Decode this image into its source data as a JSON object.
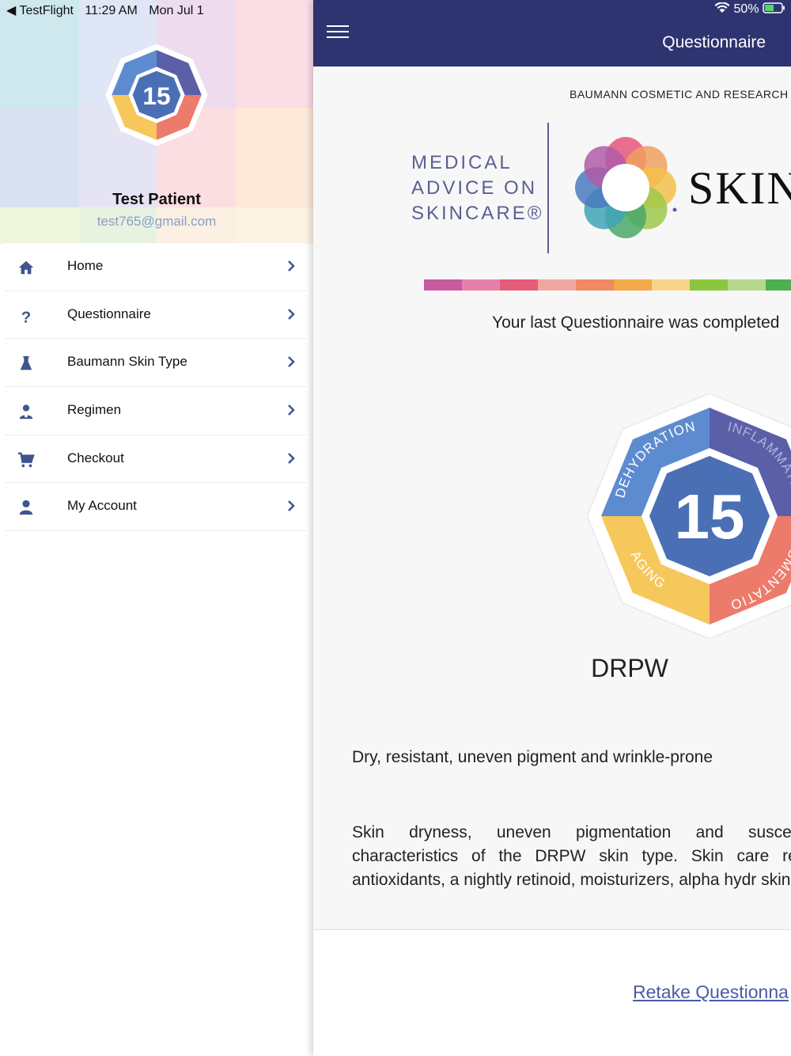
{
  "status_bar": {
    "back_app": "◀ TestFlight",
    "time": "11:29 AM",
    "date": "Mon Jul 1",
    "battery": "50%"
  },
  "drawer": {
    "badge_number": "15",
    "patient_name": "Test Patient",
    "patient_email": "test765@gmail.com",
    "menu": [
      {
        "label": "Home",
        "icon": "home-icon"
      },
      {
        "label": "Questionnaire",
        "icon": "question-icon"
      },
      {
        "label": "Baumann Skin Type",
        "icon": "flask-icon"
      },
      {
        "label": "Regimen",
        "icon": "doctor-icon"
      },
      {
        "label": "Checkout",
        "icon": "cart-icon"
      },
      {
        "label": "My Account",
        "icon": "user-icon"
      }
    ]
  },
  "navbar": {
    "title": "Questionnaire"
  },
  "content": {
    "company": "BAUMANN COSMETIC AND RESEARCH I",
    "logo_lines": [
      "MEDICAL",
      "ADVICE ON",
      "SKINCARE®"
    ],
    "logo_brand": "SKIN",
    "last_completed": "Your last Questionnaire was completed",
    "badge": {
      "number": "15",
      "segments": [
        "DEHYDRATION",
        "INFLAMMATION",
        "PIGMENTATION",
        "AGING"
      ]
    },
    "skin_type": "DRPW",
    "short_description": "Dry, resistant, uneven pigment and wrinkle-prone",
    "long_description": "Skin dryness, uneven pigmentation and susceptibility characteristics of the DRPW skin type. Skin care regimen antioxidants, a nightly retinoid, moisturizers, alpha hydr skin tone.",
    "retake": "Retake Questionna"
  },
  "colors": {
    "navbar": "#2e3470",
    "accent_blue": "#4a6fb5",
    "retake_link": "#4a5aa8",
    "band": [
      "#c85aa0",
      "#e77fab",
      "#e65d7a",
      "#f0a7a0",
      "#ef8a63",
      "#f3a94c",
      "#f6d48c",
      "#8cc63f",
      "#b6d88c",
      "#4caf50"
    ]
  }
}
